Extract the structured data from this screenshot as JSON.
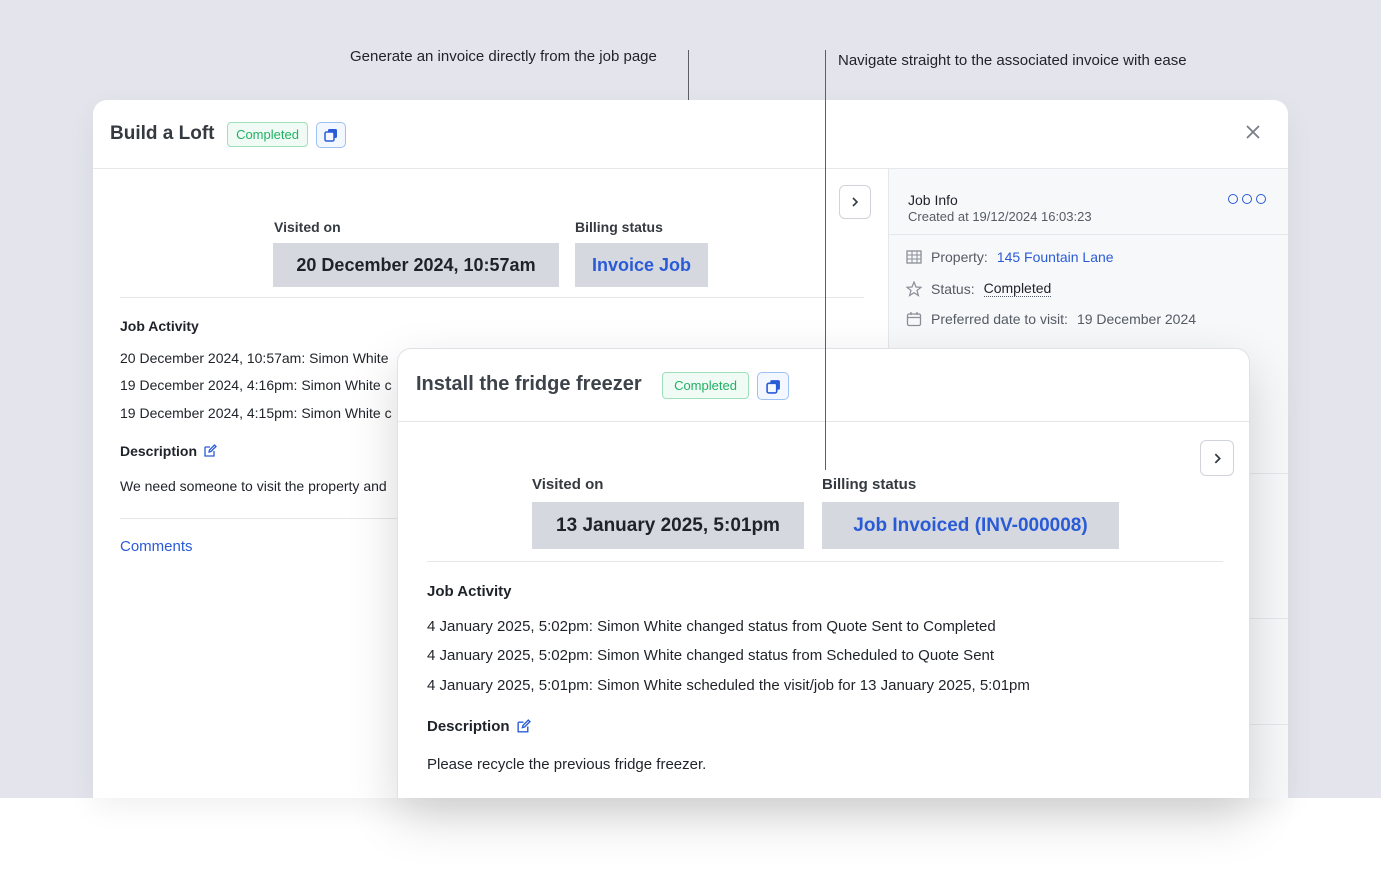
{
  "callouts": {
    "left": "Generate an invoice directly from the job page",
    "right": "Navigate straight to the associated invoice with ease"
  },
  "back_modal": {
    "title": "Build a Loft",
    "status_badge": "Completed",
    "visited_label": "Visited on",
    "visited_value": "20 December 2024, 10:57am",
    "billing_label": "Billing status",
    "billing_value": "Invoice Job",
    "activity_title": "Job Activity",
    "activity": [
      {
        "date": "20 December 2024, 10:57am:",
        "text": " Simon White"
      },
      {
        "date": "19 December 2024, 4:16pm:",
        "text": " Simon White c"
      },
      {
        "date": "19 December 2024, 4:15pm:",
        "text": " Simon White c"
      }
    ],
    "description_title": "Description",
    "description_text": "We need someone to visit the property and",
    "comments_label": "Comments"
  },
  "side_panel": {
    "title": "Job Info",
    "created": "Created at 19/12/2024 16:03:23",
    "property_label": "Property:",
    "property_value": "145 Fountain Lane",
    "status_label": "Status:",
    "status_value": "Completed",
    "preferred_label": "Preferred date to visit:",
    "preferred_value": "19 December 2024"
  },
  "front_modal": {
    "title": "Install the fridge freezer",
    "status_badge": "Completed",
    "visited_label": "Visited on",
    "visited_value": "13 January 2025, 5:01pm",
    "billing_label": "Billing status",
    "billing_value": "Job Invoiced (INV-000008)",
    "activity_title": "Job Activity",
    "activity": [
      {
        "date": "4 January 2025, 5:02pm:",
        "t1": " Simon White changed status from ",
        "b1": "Quote Sent",
        "t2": " to ",
        "b2": "Completed"
      },
      {
        "date": "4 January 2025, 5:02pm:",
        "t1": " Simon White changed status from ",
        "b1": "Scheduled",
        "t2": " to ",
        "b2": "Quote Sent"
      },
      {
        "date": "4 January 2025, 5:01pm:",
        "t1": " Simon White scheduled the visit/job for ",
        "b1": "13 January 2025, 5:01pm",
        "t2": "",
        "b2": ""
      }
    ],
    "description_title": "Description",
    "description_text": "Please recycle the previous fridge freezer."
  },
  "colors": {
    "accent": "#2a5bd7",
    "success": "#1fb264",
    "background": "#e3e4ec"
  }
}
